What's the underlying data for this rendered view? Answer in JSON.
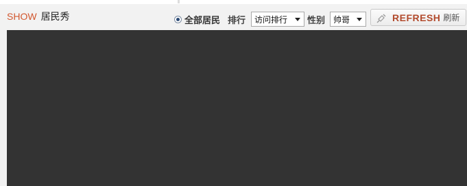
{
  "header": {
    "title_en": "SHOW",
    "title_cn": "居民秀"
  },
  "filters": {
    "scope_radio_label": "全部居民",
    "scope_selected": true,
    "sort_label": "排行",
    "sort_value": "访问排行",
    "gender_label": "性别",
    "gender_value": "帅哥"
  },
  "refresh_button": {
    "label_en": "REFRESH",
    "label_cn": "刷新",
    "icon": "refresh-icon"
  },
  "colors": {
    "accent": "#d2572f",
    "refresh_text": "#b24a2c",
    "panel_bg": "#f2f2f2",
    "content_bg": "#333333"
  }
}
